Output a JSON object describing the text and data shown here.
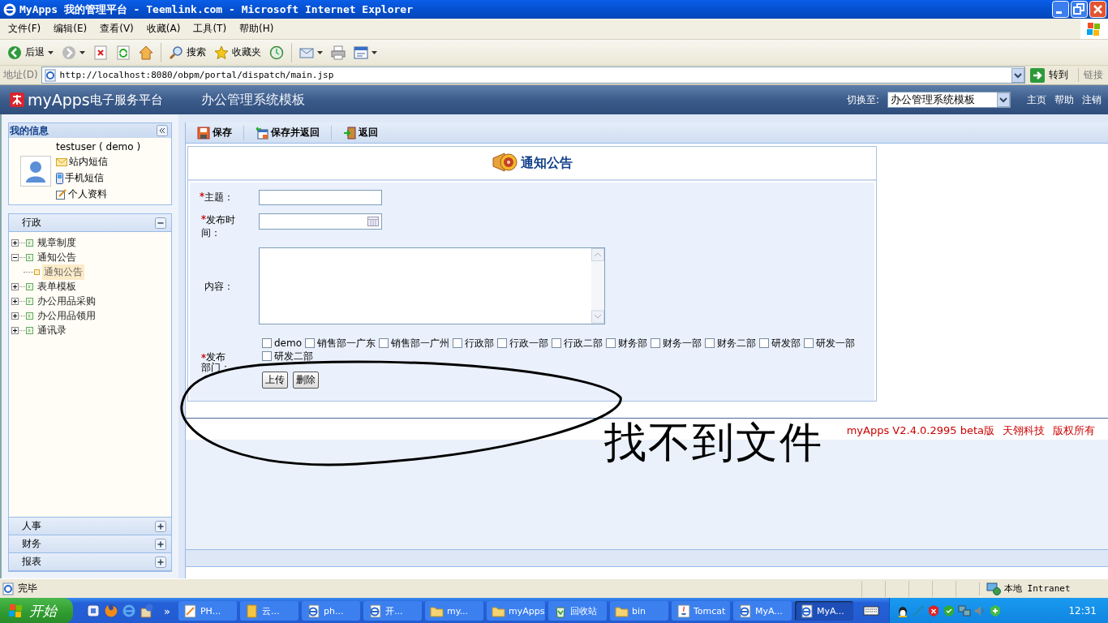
{
  "window": {
    "title": "MyApps 我的管理平台 - Teemlink.com - Microsoft Internet Explorer"
  },
  "menu": [
    "文件(F)",
    "编辑(E)",
    "查看(V)",
    "收藏(A)",
    "工具(T)",
    "帮助(H)"
  ],
  "toolbar": [
    {
      "kind": "back",
      "label": "后退"
    },
    {
      "kind": "forward"
    },
    {
      "kind": "stop"
    },
    {
      "kind": "refresh"
    },
    {
      "kind": "home"
    },
    {
      "kind": "search",
      "label": "搜索"
    },
    {
      "kind": "favorites",
      "label": "收藏夹"
    },
    {
      "kind": "history"
    },
    {
      "kind": "mail"
    },
    {
      "kind": "print"
    },
    {
      "kind": "edit"
    }
  ],
  "address": {
    "label": "地址(D)",
    "url": "http://localhost:8080/obpm/portal/dispatch/main.jsp",
    "go": "转到",
    "links": "链接"
  },
  "app_header": {
    "logo": "myApps",
    "logo_sub": "电子服务平台",
    "title": "办公管理系统模板",
    "switch_label": "切换至:",
    "switch_value": "办公管理系统模板",
    "links": [
      "主页",
      "帮助",
      "注销"
    ]
  },
  "my_info": {
    "title": "我的信息",
    "user": "testuser ( demo )",
    "links": [
      {
        "kind": "mail",
        "label": "站内短信"
      },
      {
        "kind": "phone",
        "label": "手机短信"
      },
      {
        "kind": "profile",
        "label": "个人资料"
      }
    ]
  },
  "panels": [
    {
      "title": "行政",
      "expanded": true,
      "tree": [
        {
          "label": "规章制度",
          "expanded": false,
          "selected": false
        },
        {
          "label": "通知公告",
          "expanded": true,
          "selected": false,
          "children": [
            {
              "label": "通知公告",
              "selected": true
            }
          ]
        },
        {
          "label": "表单模板",
          "expanded": false,
          "selected": false
        },
        {
          "label": "办公用品采购",
          "expanded": false,
          "selected": false
        },
        {
          "label": "办公用品领用",
          "expanded": false,
          "selected": false
        },
        {
          "label": "通讯录",
          "expanded": false,
          "selected": false
        }
      ]
    },
    {
      "title": "人事",
      "expanded": false
    },
    {
      "title": "财务",
      "expanded": false
    },
    {
      "title": "报表",
      "expanded": false
    }
  ],
  "actions": [
    {
      "kind": "save",
      "label": "保存"
    },
    {
      "kind": "save_return",
      "label": "保存并返回"
    },
    {
      "kind": "return",
      "label": "返回"
    }
  ],
  "form": {
    "title": "通知公告",
    "fields": [
      {
        "kind": "text",
        "label": "主题：",
        "required": true
      },
      {
        "kind": "date",
        "label": "发布时间：",
        "required": true
      },
      {
        "kind": "textarea",
        "label": "内容：",
        "required": false
      },
      {
        "kind": "checkboxes",
        "label": "发布部门：",
        "required": true,
        "options": [
          {
            "label": "demo",
            "checked": false
          },
          {
            "label": "销售部一广东",
            "checked": false
          },
          {
            "label": "销售部一广州",
            "checked": false
          },
          {
            "label": "行政部",
            "checked": false
          },
          {
            "label": "行政一部",
            "checked": false
          },
          {
            "label": "行政二部",
            "checked": false
          },
          {
            "label": "财务部",
            "checked": false
          },
          {
            "label": "财务一部",
            "checked": false
          },
          {
            "label": "财务二部",
            "checked": false
          },
          {
            "label": "研发部",
            "checked": false
          },
          {
            "label": "研发一部",
            "checked": false
          },
          {
            "label": "研发二部",
            "checked": false
          }
        ]
      },
      {
        "kind": "buttons",
        "buttons": [
          "上传",
          "删除"
        ]
      }
    ]
  },
  "footer": [
    "myApps V2.4.0.2995 beta版",
    "天翎科技",
    "版权所有"
  ],
  "annotation": {
    "text": "找不到文件"
  },
  "status_bar": {
    "text": "完毕",
    "zone": "本地 Intranet"
  },
  "taskbar": {
    "start": "开始",
    "more": "»",
    "tasks": [
      {
        "label": "PH...",
        "kind": "doc",
        "selected": false
      },
      {
        "label": "云...",
        "kind": "note",
        "selected": false
      },
      {
        "label": "ph...",
        "kind": "ie",
        "selected": false
      },
      {
        "label": "开...",
        "kind": "ie",
        "selected": false
      },
      {
        "label": "my...",
        "kind": "folder",
        "selected": false
      },
      {
        "label": "myApps",
        "kind": "folder",
        "selected": false
      },
      {
        "label": "回收站",
        "kind": "recycle",
        "selected": false
      },
      {
        "label": "bin",
        "kind": "folder",
        "selected": false
      },
      {
        "label": "Tomcat",
        "kind": "java",
        "selected": false
      },
      {
        "label": "MyA...",
        "kind": "ie",
        "selected": false
      },
      {
        "label": "MyA...",
        "kind": "ie",
        "selected": true
      }
    ],
    "time": "12:31"
  }
}
